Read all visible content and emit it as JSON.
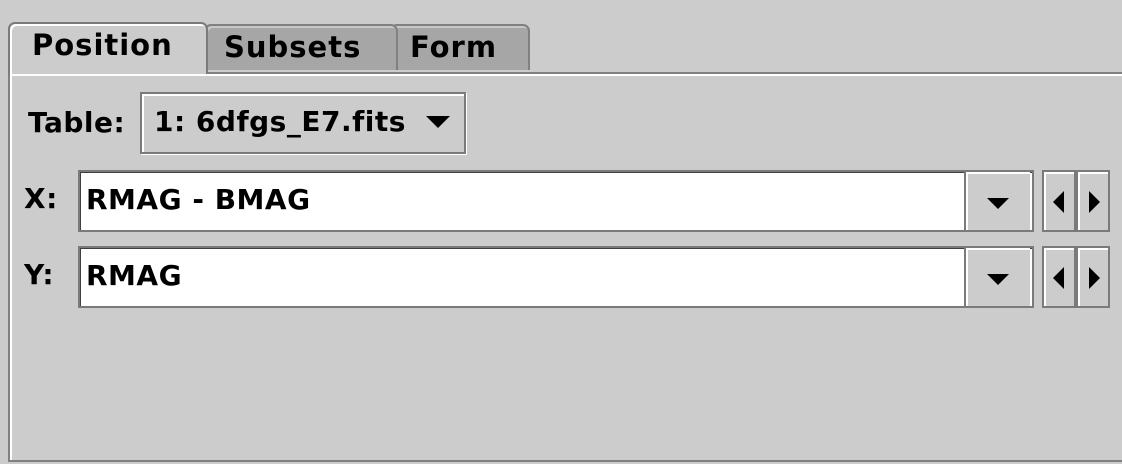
{
  "tabs": [
    {
      "label": "Position",
      "active": true
    },
    {
      "label": "Subsets",
      "active": false
    },
    {
      "label": "Form",
      "active": false
    }
  ],
  "table": {
    "label": "Table:",
    "selected": "1: 6dfgs_E7.fits"
  },
  "x_axis": {
    "label": "X:",
    "value": "RMAG - BMAG"
  },
  "y_axis": {
    "label": "Y:",
    "value": "RMAG"
  },
  "icons": {
    "dropdown": "chevron-down-icon",
    "prev": "triangle-left-icon",
    "next": "triangle-right-icon"
  }
}
